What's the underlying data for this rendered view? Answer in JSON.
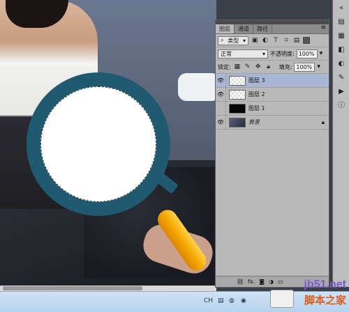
{
  "panel": {
    "tabs": [
      "图层",
      "通道",
      "路径"
    ],
    "filter": {
      "label": "类型"
    },
    "blend_mode": "正常",
    "opacity_label": "不透明度:",
    "opacity_value": "100%",
    "lock_label": "锁定:",
    "fill_label": "填充:",
    "fill_value": "100%",
    "layers": [
      {
        "name": "图层 3",
        "visible": true,
        "selected": true
      },
      {
        "name": "图层 2",
        "visible": true,
        "selected": false
      },
      {
        "name": "图层 1",
        "visible": false,
        "selected": false
      },
      {
        "name": "背景",
        "visible": true,
        "selected": false,
        "locked": true
      }
    ]
  },
  "footer": {
    "fx_label": "fx."
  },
  "taskbar": {
    "ch_label": "CH"
  },
  "watermark": {
    "url": "jb51.net",
    "brand": "脚本之家"
  },
  "colors": {
    "magnifier_ring": "#1f5a70",
    "handle": "#f5a800",
    "selected_layer": "#a9b6d4"
  }
}
